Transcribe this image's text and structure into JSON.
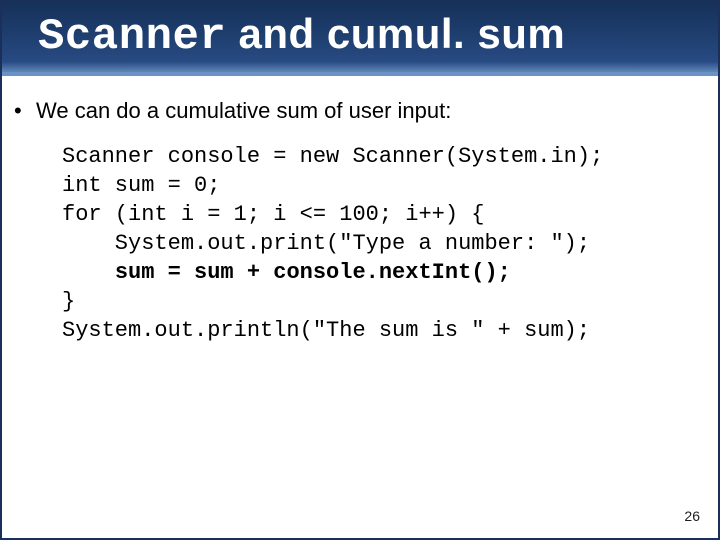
{
  "header": {
    "title_mono": "Scanner",
    "title_rest": " and cumul. sum"
  },
  "bullet": {
    "mark": "•",
    "text": "We can do a cumulative sum of user input:"
  },
  "code": {
    "l1": "Scanner console = new Scanner(System.in);",
    "l2": "int sum = 0;",
    "l3": "for (int i = 1; i <= 100; i++) {",
    "l4": "    System.out.print(\"Type a number: \");",
    "l5_a": "    ",
    "l5_b": "sum = sum + console.nextInt();",
    "l6": "}",
    "l7": "System.out.println(\"The sum is \" + sum);"
  },
  "page_number": "26"
}
